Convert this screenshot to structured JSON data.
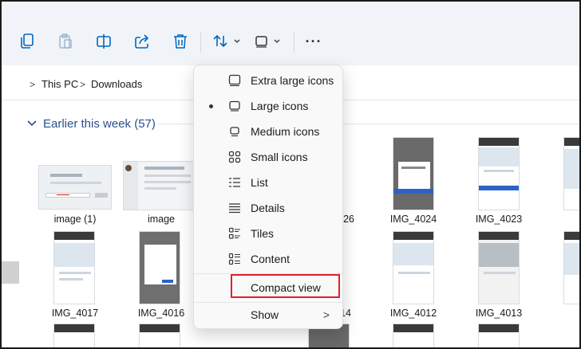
{
  "toolbar": {
    "icons": [
      "copy-icon",
      "paste-icon",
      "rename-icon",
      "share-icon",
      "delete-icon",
      "sort-icon",
      "view-icon",
      "more-icon"
    ],
    "more_label": "···"
  },
  "address": {
    "crumbs": [
      "This PC",
      "Downloads"
    ],
    "separator": ">"
  },
  "group": {
    "title": "Earlier this week (57)"
  },
  "files": [
    {
      "name": "image (1)"
    },
    {
      "name": "image"
    },
    {
      "name": "26"
    },
    {
      "name": "IMG_4024"
    },
    {
      "name": "IMG_4023"
    },
    {
      "name": "IMG_4017"
    },
    {
      "name": "IMG_4016"
    },
    {
      "name": "14"
    },
    {
      "name": "IMG_4012"
    },
    {
      "name": "IMG_4013"
    }
  ],
  "menu": {
    "items": [
      {
        "label": "Extra large icons"
      },
      {
        "label": "Large icons",
        "selected": true
      },
      {
        "label": "Medium icons"
      },
      {
        "label": "Small icons"
      },
      {
        "label": "List"
      },
      {
        "label": "Details"
      },
      {
        "label": "Tiles"
      },
      {
        "label": "Content"
      },
      {
        "label": "Compact view",
        "highlighted": true
      },
      {
        "label": "Show",
        "submenu": true
      }
    ],
    "submenu_arrow": ">"
  },
  "colors": {
    "accent": "#0067c0",
    "group_header": "#2a4f8f",
    "highlight_box": "#e0202a",
    "toolbar_bg": "#f0f4f9"
  }
}
